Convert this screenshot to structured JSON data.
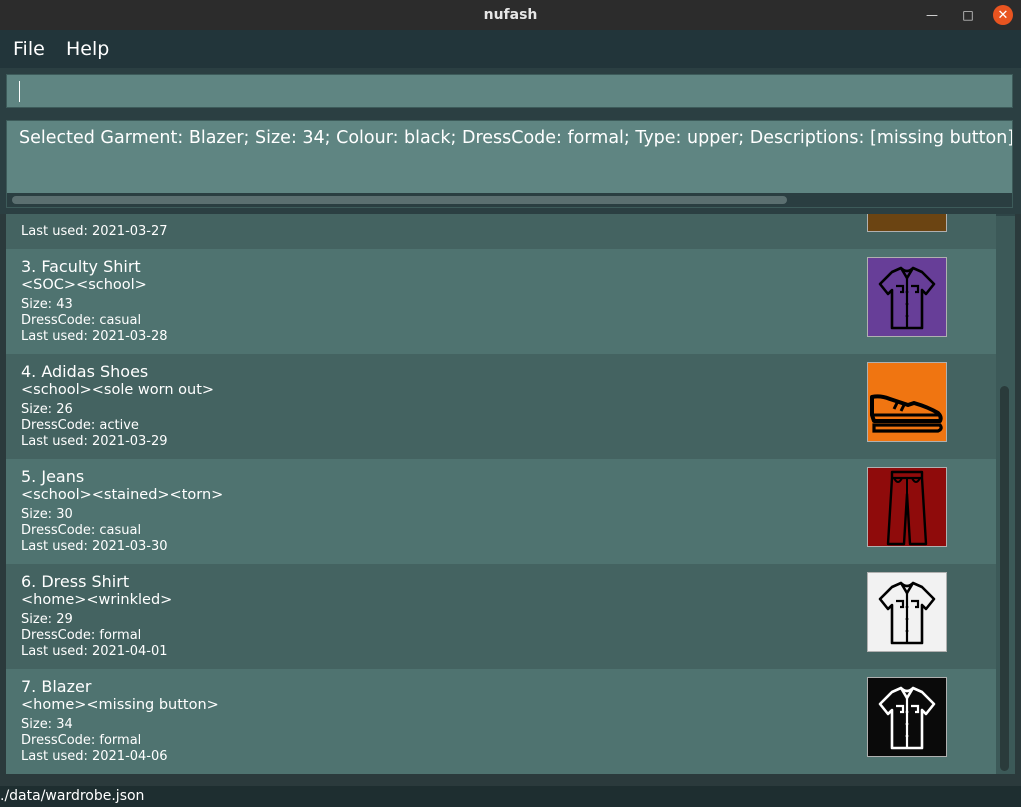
{
  "window": {
    "title": "nufash"
  },
  "menu": {
    "file": "File",
    "help": "Help"
  },
  "command_box": {
    "value": ""
  },
  "result": {
    "text": "Selected Garment: Blazer; Size: 34; Colour: black; DressCode: formal; Type: upper; Descriptions: [missing button]"
  },
  "partial_item": {
    "last_used": "Last used: 2021-03-27"
  },
  "garments": [
    {
      "index": "3.",
      "name": "Faculty Shirt",
      "tags": "<SOC><school>",
      "size": "Size: 43",
      "dresscode": "DressCode: casual",
      "last_used": "Last used: 2021-03-28",
      "icon": "shirt-icon",
      "color": "#673e98"
    },
    {
      "index": "4.",
      "name": "Adidas Shoes",
      "tags": "<school><sole worn out>",
      "size": "Size: 26",
      "dresscode": "DressCode: active",
      "last_used": "Last used: 2021-03-29",
      "icon": "shoe-icon",
      "color": "#f07511"
    },
    {
      "index": "5.",
      "name": "Jeans",
      "tags": "<school><stained><torn>",
      "size": "Size: 30",
      "dresscode": "DressCode: casual",
      "last_used": "Last used: 2021-03-30",
      "icon": "pants-icon",
      "color": "#8f0b0b"
    },
    {
      "index": "6.",
      "name": "Dress Shirt",
      "tags": "<home><wrinkled>",
      "size": "Size: 29",
      "dresscode": "DressCode: formal",
      "last_used": "Last used: 2021-04-01",
      "icon": "shirt-icon",
      "color": "#f2f2f2"
    },
    {
      "index": "7.",
      "name": "Blazer",
      "tags": "<home><missing button>",
      "size": "Size: 34",
      "dresscode": "DressCode: formal",
      "last_used": "Last used: 2021-04-06",
      "icon": "shirt-icon",
      "color": "#0a0a0a"
    }
  ],
  "status": {
    "path": "./data/wardrobe.json"
  }
}
